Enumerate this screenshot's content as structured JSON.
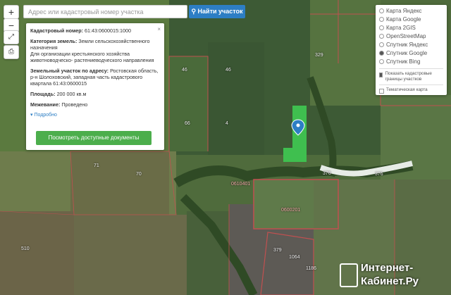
{
  "search": {
    "placeholder": "Адрес или кадастровый номер участка",
    "button_label": "Найти участок"
  },
  "toolbar": {
    "zoom_in": "+",
    "zoom_out": "−"
  },
  "parcel": {
    "cad_label": "Кадастровый номер:",
    "cad_value": "61:43:0600015:1000",
    "cat_label": "Категория земель:",
    "cat_value": "Земли сельскохозяйственного назначения",
    "use_value": "Для организации крестьянского хозяйства животноводческо- растениеводческого направления",
    "addr_label": "Земельный участок по адресу:",
    "addr_value": "Ростовская область, р-н Шолоховский, западная часть кадастрового квартала 61:43:0600015",
    "area_label": "Площадь:",
    "area_value": "200 000 кв.м",
    "border_label": "Межевание:",
    "border_value": "Проведено",
    "more_label": "Подробно",
    "docs_button": "Посмотреть доступные документы",
    "close": "×"
  },
  "layers": {
    "items": [
      "Карта Яндекс",
      "Карта Google",
      "Карта 2GIS",
      "OpenStreetMap",
      "Спутник Яндекс",
      "Спутник Google",
      "Спутник Bing"
    ],
    "selected": "Спутник Google",
    "show_borders": "Показать кадастровые границы участков",
    "thematic": "Тематическая карта"
  },
  "map_labels": {
    "l1": "46",
    "l2": "46",
    "l3": "329",
    "l4": "4",
    "l5": "66",
    "l6": "71",
    "l7": "70",
    "l8": "0610401",
    "l9": "0600201",
    "l10": "376",
    "l11": "376",
    "l12": "510",
    "l13": "1186",
    "l14": "1064",
    "l15": "379"
  },
  "watermark": {
    "line1": "Интернет-",
    "line2": "Кабинет.Ру"
  }
}
